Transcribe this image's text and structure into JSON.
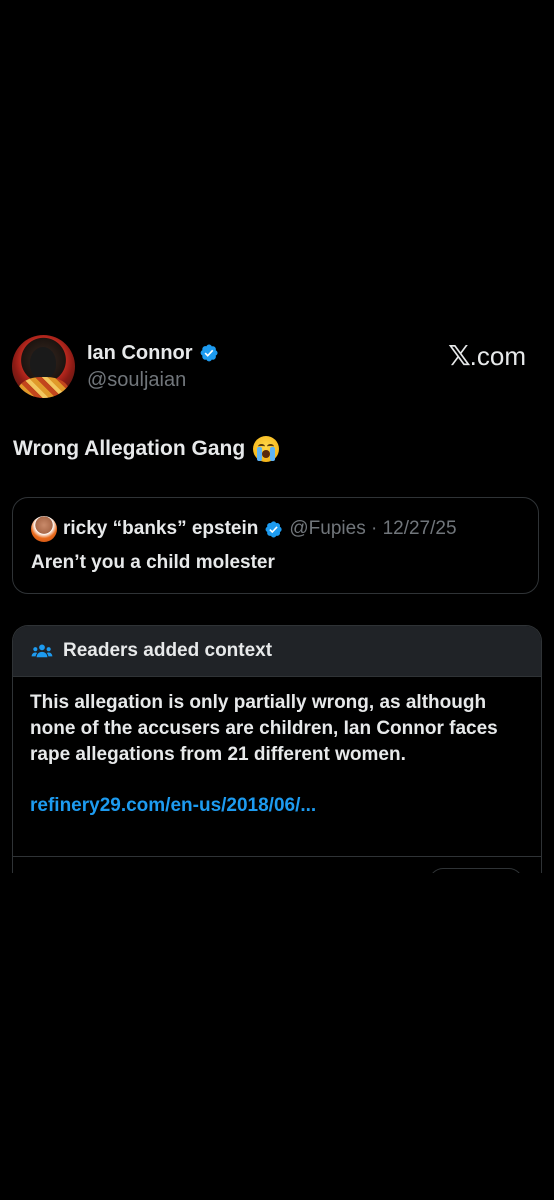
{
  "author": {
    "display_name": "Ian Connor",
    "handle": "@souljaian",
    "verified": true
  },
  "brand": {
    "label": ".com",
    "icon": "x-logo-icon"
  },
  "tweet": {
    "text": "Wrong Allegation Gang",
    "emoji": "loudly-crying-face-icon"
  },
  "quoted_tweet": {
    "display_name": "ricky “banks” epstein",
    "handle_and_date": "@Fupies · 12/27/25",
    "text": "Aren’t you a child molester",
    "verified": true
  },
  "community_note": {
    "title": "Readers added context",
    "icon": "people-icon",
    "body": "This allegation is only partially wrong, as although none of the accusers are children, Ian Connor faces rape allegations from 21 different women.",
    "link": "refinery29.com/en-us/2018/06/..."
  },
  "colors": {
    "background": "#000000",
    "text": "#e7e9ea",
    "muted": "#71767b",
    "link": "#1d9bf0",
    "border": "#2f3336",
    "note_header": "#202327",
    "verified": "#1d9bf0"
  }
}
